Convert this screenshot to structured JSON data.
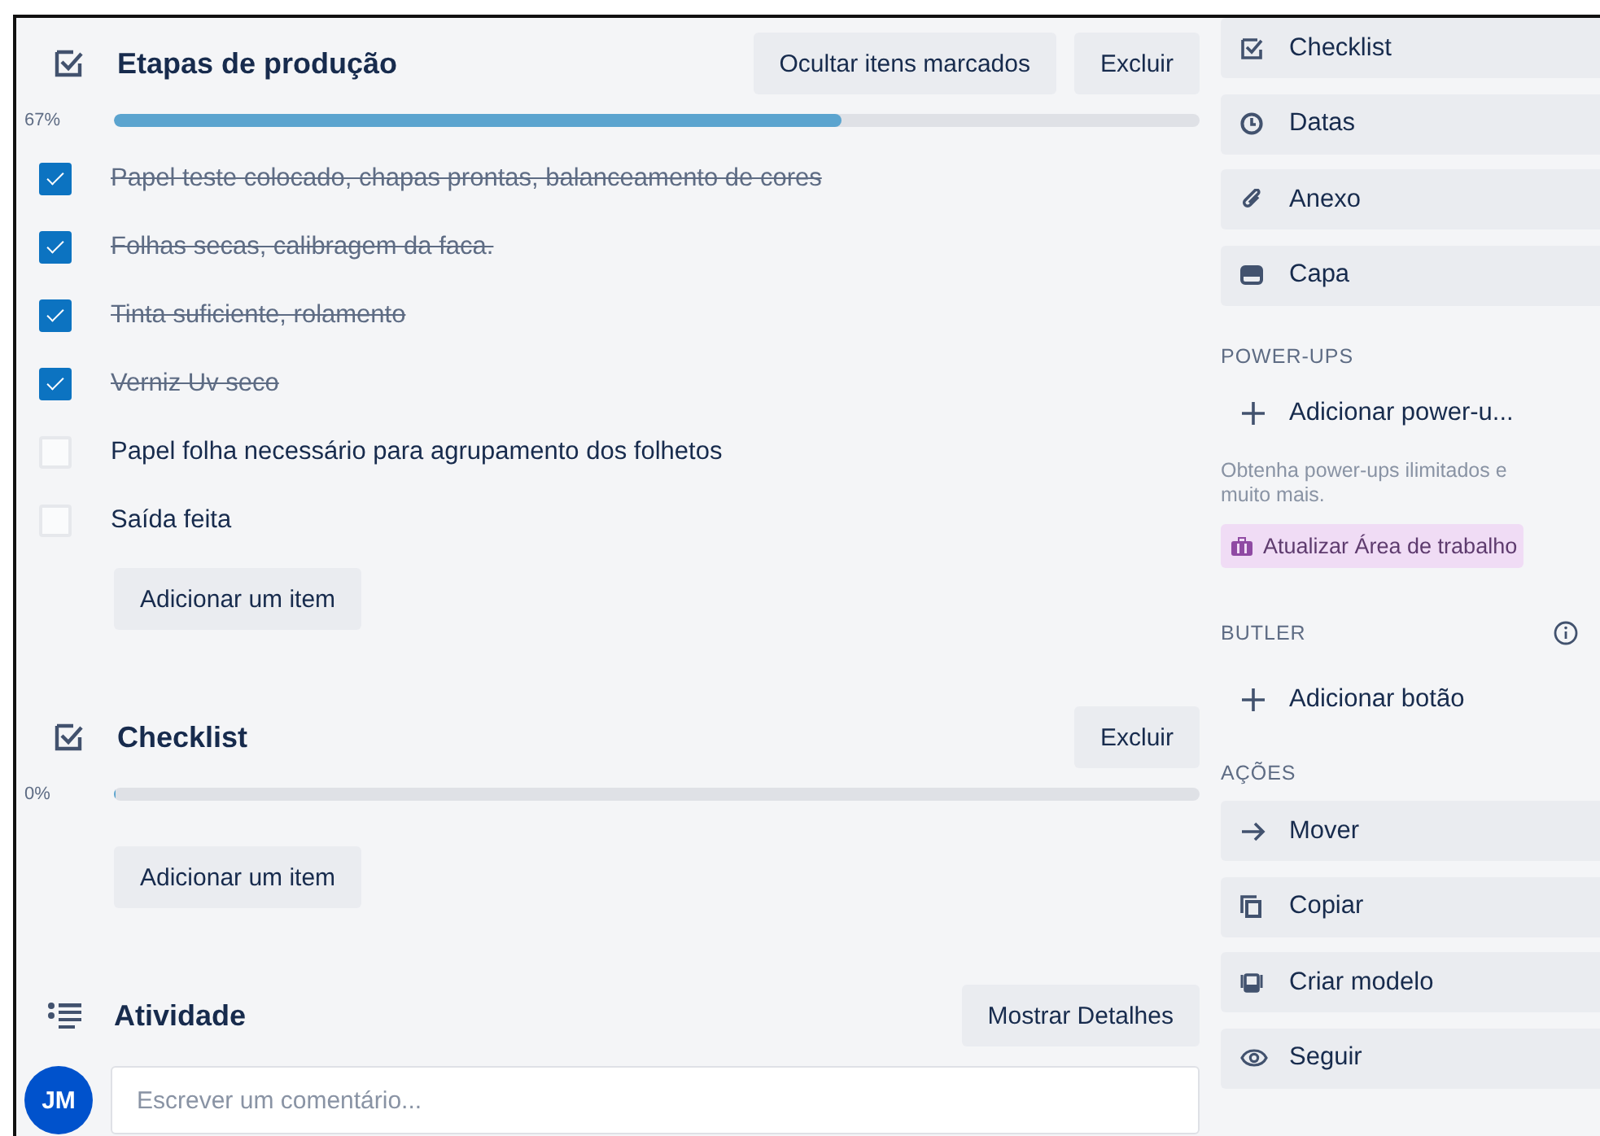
{
  "checklists": [
    {
      "title": "Etapas de produção",
      "percent": "67%",
      "level": 0.67,
      "buttons": [
        "Ocultar itens marcados",
        "Excluir"
      ],
      "items": [
        {
          "text": "Papel teste colocado, chapas prontas, balanceamento de cores",
          "checked": true
        },
        {
          "text": "Folhas secas, calibragem da faca.",
          "checked": true
        },
        {
          "text": "Tinta suficiente, rolamento",
          "checked": true
        },
        {
          "text": "Verniz Uv seco",
          "checked": true
        },
        {
          "text": "Papel folha necessário para agrupamento dos folhetos",
          "checked": false
        },
        {
          "text": "Saída feita",
          "checked": false
        }
      ],
      "add_button": "Adicionar um item"
    },
    {
      "title": "Checklist",
      "percent": "0%",
      "level": 0,
      "buttons": [
        "Excluir"
      ],
      "add_button": "Adicionar um item"
    }
  ],
  "activity": {
    "title": "Atividade",
    "button": "Mostrar Detalhes",
    "avatar": "JM",
    "comment": {
      "placeholder": "Escrever um comentário..."
    }
  },
  "sidebar": {
    "add_buttons": [
      "Checklist",
      "Datas",
      "Anexo",
      "Capa"
    ],
    "power_ups": {
      "heading": "POWER-UPS",
      "add": "Adicionar power-u...",
      "note": "Obtenha power-ups ilimitados e muito mais.",
      "upgrade": "Atualizar Área de trabalho"
    },
    "butler": {
      "heading": "BUTLER",
      "add": "Adicionar botão"
    },
    "actions": {
      "heading": "AÇÕES",
      "buttons": [
        "Mover",
        "Copiar",
        "Criar modelo",
        "Seguir"
      ]
    }
  }
}
